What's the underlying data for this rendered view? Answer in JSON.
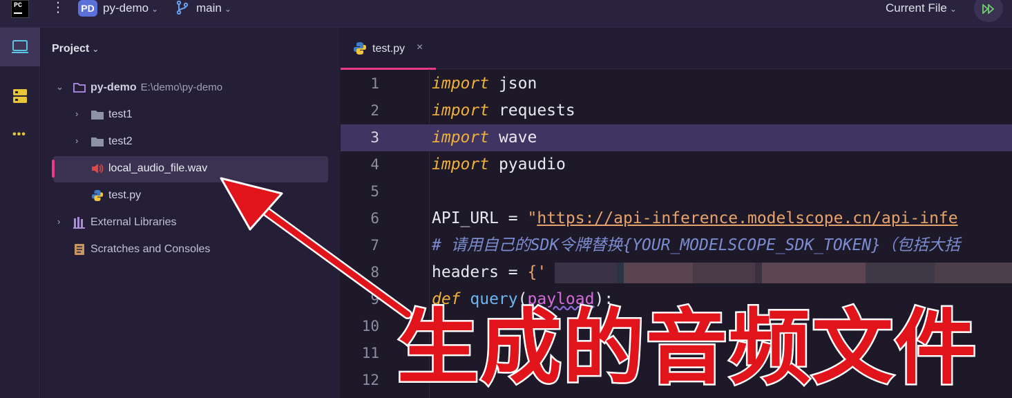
{
  "titlebar": {
    "logo_text": "PC",
    "project_badge": "PD",
    "project_name": "py-demo",
    "branch_name": "main",
    "run_config": "Current File",
    "run_icon": "run-debug-icon"
  },
  "toolstrip": {
    "items": [
      "project-icon",
      "structure-icon",
      "more-icon"
    ],
    "more_label": "•••"
  },
  "project_panel": {
    "header": "Project",
    "tree": [
      {
        "label": "py-demo",
        "path": "E:\\demo\\py-demo",
        "icon": "module-folder-icon",
        "expanded": true,
        "level": 0
      },
      {
        "label": "test1",
        "icon": "folder-icon",
        "expanded": false,
        "level": 1
      },
      {
        "label": "test2",
        "icon": "folder-icon",
        "expanded": false,
        "level": 1
      },
      {
        "label": "local_audio_file.wav",
        "icon": "audio-file-icon",
        "selected": true,
        "level": 1
      },
      {
        "label": "test.py",
        "icon": "python-file-icon",
        "level": 1
      },
      {
        "label": "External Libraries",
        "icon": "library-icon",
        "expanded": false,
        "level": 0
      },
      {
        "label": "Scratches and Consoles",
        "icon": "scratches-icon",
        "level": 0
      }
    ]
  },
  "editor": {
    "tab_label": "test.py",
    "tab_close": "×",
    "highlighted_line": 3,
    "lines": [
      {
        "num": "1",
        "kw": "import",
        "rest": " json"
      },
      {
        "num": "2",
        "kw": "import",
        "rest": " requests"
      },
      {
        "num": "3",
        "kw": "import",
        "rest": " wave"
      },
      {
        "num": "4",
        "kw": "import",
        "rest": " pyaudio"
      },
      {
        "num": "5",
        "text": ""
      },
      {
        "num": "6",
        "var": "API_URL = ",
        "quote": "\"",
        "url": "https://api-inference.modelscope.cn/api-infe"
      },
      {
        "num": "7",
        "comment": "# 请用自己的SDK令牌替换{YOUR_MODELSCOPE_SDK_TOKEN}（包括大括"
      },
      {
        "num": "8",
        "var": "headers = ",
        "brace": "{'"
      },
      {
        "num": "9",
        "kw": "def",
        "fn": " query",
        "open": "(",
        "param": "payload",
        "close": "):"
      },
      {
        "num": "10",
        "text": ""
      },
      {
        "num": "11",
        "text": ""
      },
      {
        "num": "12",
        "text": ""
      }
    ]
  },
  "annotation": {
    "text": "生成的音频文件"
  },
  "colors": {
    "accent": "#e93a8c",
    "keyword": "#f0b13a",
    "string": "#e7a36a",
    "comment": "#7b8cd0",
    "annotation_red": "#e1141b",
    "line_highlight": "#403462"
  }
}
